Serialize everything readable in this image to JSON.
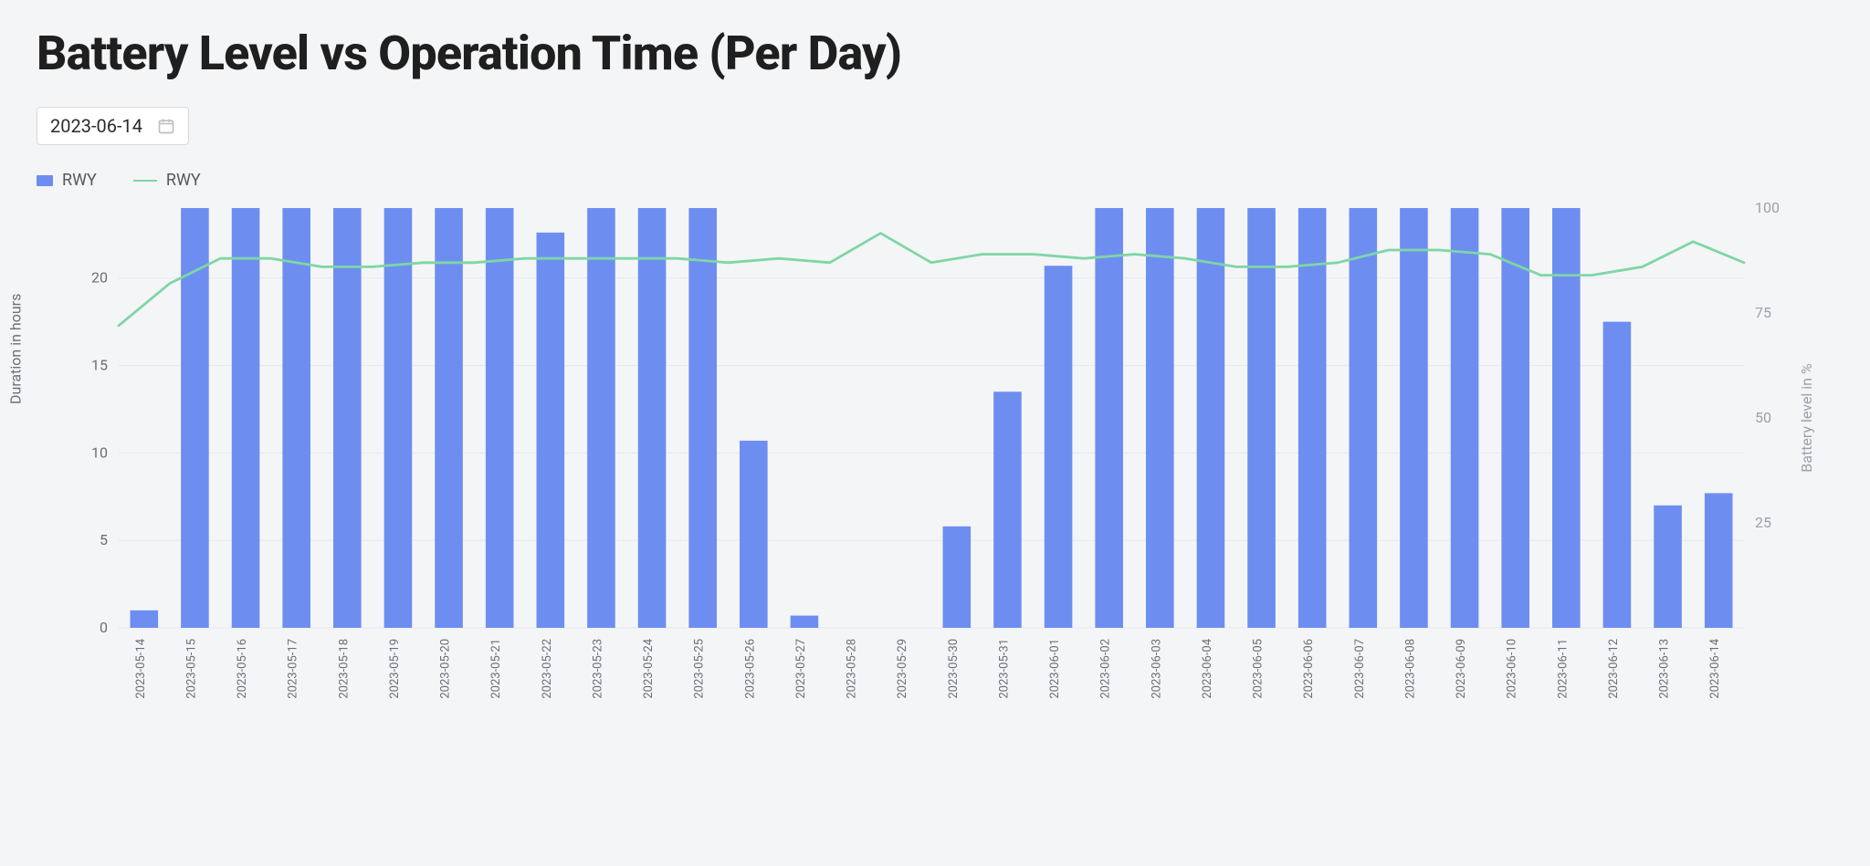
{
  "title": "Battery Level vs Operation Time (Per Day)",
  "date_picker": {
    "value": "2023-06-14"
  },
  "legend": {
    "bar_label": "RWY",
    "line_label": "RWY"
  },
  "colors": {
    "bar": "#6d8ef0",
    "line": "#7ed6a5",
    "grid": "#e6e8ec"
  },
  "chart_data": {
    "type": "bar+line",
    "xlabel": "",
    "ylabel_left": "Duration in hours",
    "ylabel_right": "Battery level in %",
    "ylim_left": [
      0,
      24
    ],
    "yticks_left": [
      0,
      5,
      10,
      15,
      20
    ],
    "ylim_right": [
      0,
      100
    ],
    "yticks_right": [
      25,
      50,
      75,
      100
    ],
    "categories": [
      "2023-05-14",
      "2023-05-15",
      "2023-05-16",
      "2023-05-17",
      "2023-05-18",
      "2023-05-19",
      "2023-05-20",
      "2023-05-21",
      "2023-05-22",
      "2023-05-23",
      "2023-05-24",
      "2023-05-25",
      "2023-05-26",
      "2023-05-27",
      "2023-05-28",
      "2023-05-29",
      "2023-05-30",
      "2023-05-31",
      "2023-06-01",
      "2023-06-02",
      "2023-06-03",
      "2023-06-04",
      "2023-06-05",
      "2023-06-06",
      "2023-06-07",
      "2023-06-08",
      "2023-06-09",
      "2023-06-10",
      "2023-06-11",
      "2023-06-12",
      "2023-06-13",
      "2023-06-14"
    ],
    "series": [
      {
        "name": "RWY",
        "kind": "bar",
        "axis": "left",
        "values": [
          1.0,
          24,
          24,
          24,
          24,
          24,
          24,
          24,
          22.6,
          24,
          24,
          24,
          10.7,
          0.7,
          0,
          0,
          5.8,
          13.5,
          20.7,
          24,
          24,
          24,
          24,
          24,
          24,
          24,
          24,
          24,
          24,
          17.5,
          7.0,
          7.7
        ]
      },
      {
        "name": "RWY",
        "kind": "line",
        "axis": "right",
        "values": [
          72,
          82,
          88,
          88,
          86,
          86,
          87,
          87,
          88,
          88,
          88,
          88,
          87,
          88,
          87,
          94,
          87,
          89,
          89,
          88,
          89,
          88,
          86,
          86,
          87,
          90,
          90,
          89,
          84,
          84,
          86,
          92,
          87
        ]
      }
    ]
  }
}
